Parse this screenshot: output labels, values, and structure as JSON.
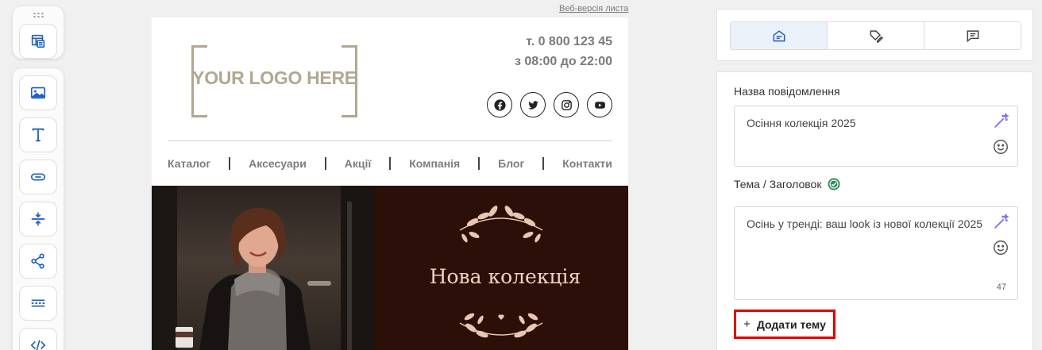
{
  "toolbar": {
    "top_tool": {
      "name": "Блоки",
      "icon": "layout-blocks-icon"
    },
    "tools": [
      {
        "icon": "image-icon"
      },
      {
        "icon": "text-icon"
      },
      {
        "icon": "button-icon"
      },
      {
        "icon": "spacer-icon"
      },
      {
        "icon": "share-icon"
      },
      {
        "icon": "divider-icon"
      },
      {
        "icon": "code-icon"
      }
    ]
  },
  "email": {
    "web_version_link": "Веб-версія листа",
    "logo_text": "YOUR LOGO HERE",
    "phone": "т. 0 800 123 45",
    "hours": "з 08:00 до 22:00",
    "socials": [
      "facebook-icon",
      "twitter-icon",
      "instagram-icon",
      "youtube-icon"
    ],
    "menu": [
      "Каталог",
      "Аксесуари",
      "Акції",
      "Компанія",
      "Блог",
      "Контакти"
    ],
    "hero_title": "Нова колекція"
  },
  "panel": {
    "tabs": [
      {
        "icon": "email-settings-icon",
        "active": true
      },
      {
        "icon": "tag-edit-icon",
        "active": false
      },
      {
        "icon": "message-icon",
        "active": false
      }
    ],
    "message_name": {
      "label": "Назва повідомлення",
      "value": "Осіння колекція 2025"
    },
    "subject": {
      "label": "Тема / Заголовок",
      "value": "Осінь у тренді: ваш look із нової колекції 2025",
      "char_count": "47"
    },
    "add_topic_label": "Додати тему",
    "add_topic_plus": "+"
  },
  "colors": {
    "logo": "#b2a792",
    "hero_bg": "#2b0f08",
    "hero_text": "#f1d2c2",
    "accent_blue": "#1f5fbf",
    "highlight_red": "#e30000",
    "check_green": "#2e8b57",
    "magic_purple": "#8a6ff0"
  }
}
